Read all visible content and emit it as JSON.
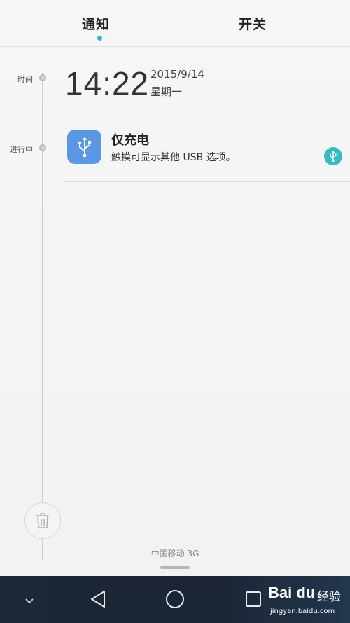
{
  "tabs": {
    "notifications": "通知",
    "switches": "开关"
  },
  "timeline": {
    "time_label": "时间",
    "ongoing_label": "进行中"
  },
  "clock": {
    "time": "14:22",
    "date": "2015/9/14",
    "weekday": "星期一"
  },
  "notification": {
    "title": "仅充电",
    "text": "触摸可显示其他 USB 选项。",
    "icon": "usb-icon",
    "badge_icon": "usb-icon"
  },
  "carrier": "中国移动 3G",
  "navbar": {
    "icons": [
      "chevron-down-icon",
      "back-icon",
      "home-icon",
      "recent-apps-icon"
    ]
  },
  "watermark": {
    "logo": "Bai du",
    "text": "经验",
    "url": "jingyan.baidu.com"
  },
  "colors": {
    "accent": "#2fb7c6",
    "app_icon_bg": "#5a98e6",
    "navbar_bg": "#1d2836"
  }
}
